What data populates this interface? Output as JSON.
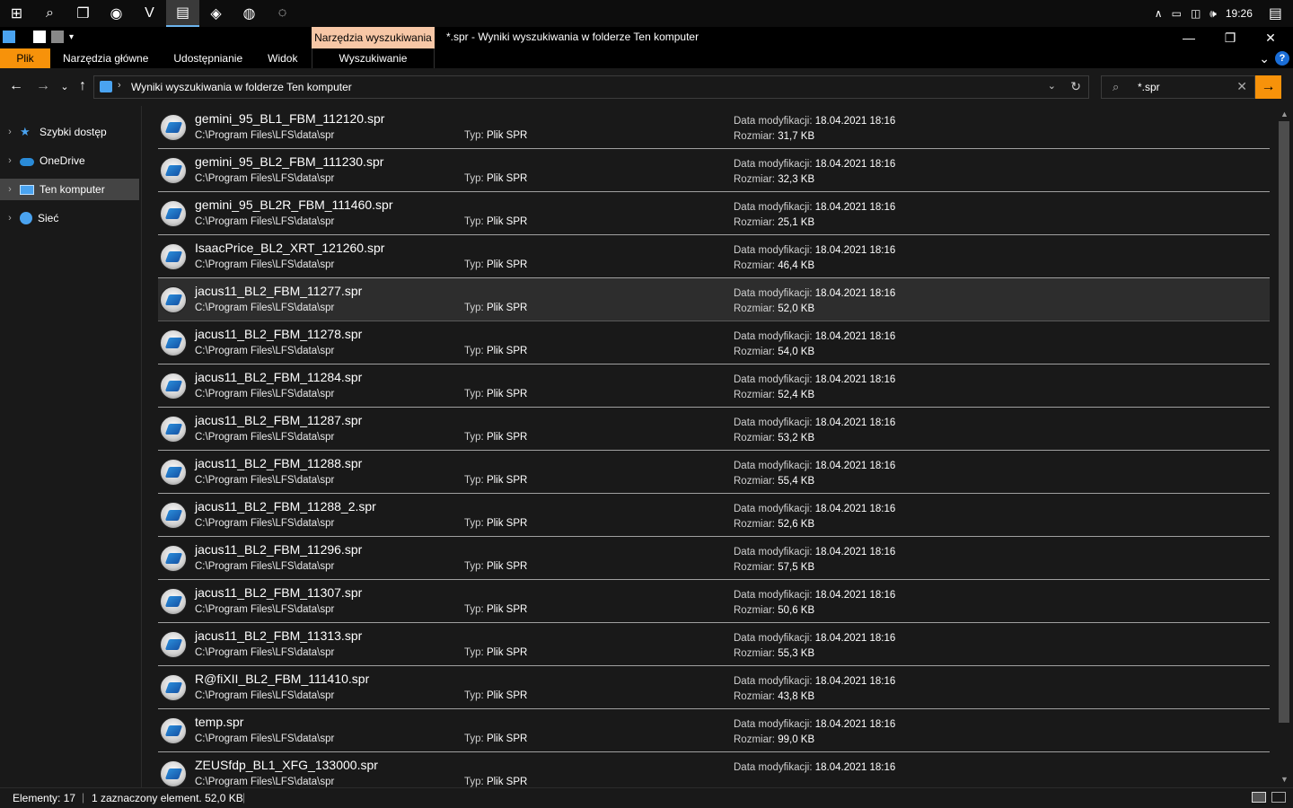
{
  "taskbar": {
    "apps": [
      {
        "name": "start-button",
        "glyph": "⊞"
      },
      {
        "name": "search-button",
        "glyph": "⌕"
      },
      {
        "name": "task-view-button",
        "glyph": "❐"
      },
      {
        "name": "firefox-app",
        "glyph": "◉"
      },
      {
        "name": "vscode-app",
        "glyph": "V"
      },
      {
        "name": "file-explorer-app",
        "glyph": "▤"
      },
      {
        "name": "lfs-app",
        "glyph": "◈"
      },
      {
        "name": "steam-app",
        "glyph": "◍"
      },
      {
        "name": "app-generic",
        "glyph": "◌"
      }
    ],
    "tray_icons": [
      "∧",
      "▭",
      "◫",
      "🕪"
    ],
    "clock": "19:26",
    "notification_glyph": "▤"
  },
  "titlebar": {
    "context_tab": "Narzędzia wyszukiwania",
    "title": "*.spr - Wyniki wyszukiwania w folderze Ten komputer",
    "minimize": "—",
    "maximize": "❐",
    "close": "✕"
  },
  "ribbon": {
    "tabs": [
      "Plik",
      "Narzędzia główne",
      "Udostępnianie",
      "Widok"
    ],
    "context_tab": "Wyszukiwanie",
    "expand_glyph": "⌄",
    "help": "?"
  },
  "navigation": {
    "back": "←",
    "forward": "→",
    "recent": "⌄",
    "up": "↑",
    "breadcrumb_sep": "›",
    "address": "Wyniki wyszukiwania w folderze Ten komputer",
    "dropdown": "⌄",
    "refresh": "↻",
    "search_value": "*.spr",
    "search_icon": "⌕",
    "search_clear": "✕",
    "search_go": "→"
  },
  "sidebar": {
    "items": [
      {
        "label": "Szybki dostęp",
        "icon": "star-icon",
        "color": "#4aa3f0"
      },
      {
        "label": "OneDrive",
        "icon": "cloud-icon",
        "color": "#2a8bd8"
      },
      {
        "label": "Ten komputer",
        "icon": "computer-icon",
        "color": "#4aa3f0",
        "selected": true
      },
      {
        "label": "Sieć",
        "icon": "network-icon",
        "color": "#4aa3f0"
      }
    ]
  },
  "labels": {
    "type_label": "Typ:",
    "date_label": "Data modyfikacji:",
    "size_label": "Rozmiar:"
  },
  "files": [
    {
      "name": "gemini_95_BL1_FBM_112120.spr",
      "path": "C:\\Program Files\\LFS\\data\\spr",
      "type": "Plik SPR",
      "date": "18.04.2021 18:16",
      "size": "31,7 KB"
    },
    {
      "name": "gemini_95_BL2_FBM_111230.spr",
      "path": "C:\\Program Files\\LFS\\data\\spr",
      "type": "Plik SPR",
      "date": "18.04.2021 18:16",
      "size": "32,3 KB"
    },
    {
      "name": "gemini_95_BL2R_FBM_111460.spr",
      "path": "C:\\Program Files\\LFS\\data\\spr",
      "type": "Plik SPR",
      "date": "18.04.2021 18:16",
      "size": "25,1 KB"
    },
    {
      "name": "IsaacPrice_BL2_XRT_121260.spr",
      "path": "C:\\Program Files\\LFS\\data\\spr",
      "type": "Plik SPR",
      "date": "18.04.2021 18:16",
      "size": "46,4 KB"
    },
    {
      "name": "jacus11_BL2_FBM_11277.spr",
      "path": "C:\\Program Files\\LFS\\data\\spr",
      "type": "Plik SPR",
      "date": "18.04.2021 18:16",
      "size": "52,0 KB",
      "hover": true
    },
    {
      "name": "jacus11_BL2_FBM_11278.spr",
      "path": "C:\\Program Files\\LFS\\data\\spr",
      "type": "Plik SPR",
      "date": "18.04.2021 18:16",
      "size": "54,0 KB"
    },
    {
      "name": "jacus11_BL2_FBM_11284.spr",
      "path": "C:\\Program Files\\LFS\\data\\spr",
      "type": "Plik SPR",
      "date": "18.04.2021 18:16",
      "size": "52,4 KB"
    },
    {
      "name": "jacus11_BL2_FBM_11287.spr",
      "path": "C:\\Program Files\\LFS\\data\\spr",
      "type": "Plik SPR",
      "date": "18.04.2021 18:16",
      "size": "53,2 KB"
    },
    {
      "name": "jacus11_BL2_FBM_11288.spr",
      "path": "C:\\Program Files\\LFS\\data\\spr",
      "type": "Plik SPR",
      "date": "18.04.2021 18:16",
      "size": "55,4 KB"
    },
    {
      "name": "jacus11_BL2_FBM_11288_2.spr",
      "path": "C:\\Program Files\\LFS\\data\\spr",
      "type": "Plik SPR",
      "date": "18.04.2021 18:16",
      "size": "52,6 KB"
    },
    {
      "name": "jacus11_BL2_FBM_11296.spr",
      "path": "C:\\Program Files\\LFS\\data\\spr",
      "type": "Plik SPR",
      "date": "18.04.2021 18:16",
      "size": "57,5 KB"
    },
    {
      "name": "jacus11_BL2_FBM_11307.spr",
      "path": "C:\\Program Files\\LFS\\data\\spr",
      "type": "Plik SPR",
      "date": "18.04.2021 18:16",
      "size": "50,6 KB"
    },
    {
      "name": "jacus11_BL2_FBM_11313.spr",
      "path": "C:\\Program Files\\LFS\\data\\spr",
      "type": "Plik SPR",
      "date": "18.04.2021 18:16",
      "size": "55,3 KB"
    },
    {
      "name": "R@fiXII_BL2_FBM_111410.spr",
      "path": "C:\\Program Files\\LFS\\data\\spr",
      "type": "Plik SPR",
      "date": "18.04.2021 18:16",
      "size": "43,8 KB"
    },
    {
      "name": "temp.spr",
      "path": "C:\\Program Files\\LFS\\data\\spr",
      "type": "Plik SPR",
      "date": "18.04.2021 18:16",
      "size": "99,0 KB"
    },
    {
      "name": "ZEUSfdp_BL1_XFG_133000.spr",
      "path": "C:\\Program Files\\LFS\\data\\spr",
      "type": "Plik SPR",
      "date": "18.04.2021 18:16",
      "size": ""
    }
  ],
  "statusbar": {
    "count": "Elementy: 17",
    "selection": "1 zaznaczony element. 52,0 KB"
  },
  "colors": {
    "accent": "#f7920a",
    "context_tab": "#f7c7a6",
    "background": "#191919"
  }
}
